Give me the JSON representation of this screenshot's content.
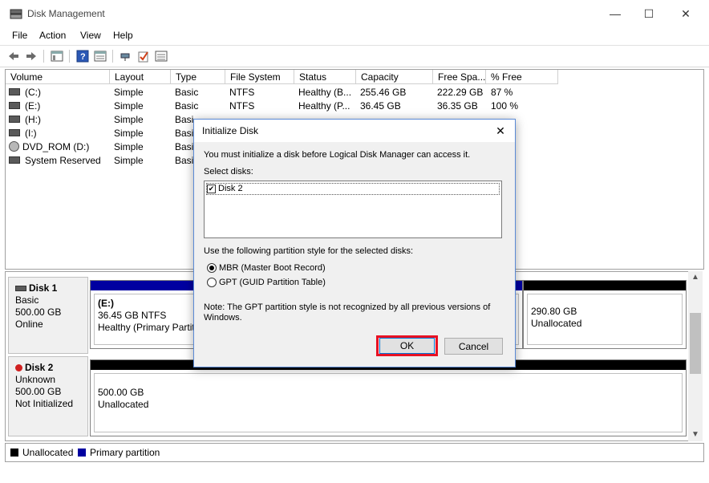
{
  "window": {
    "title": "Disk Management",
    "minimize": "—",
    "maximize": "☐",
    "close": "✕"
  },
  "menu": [
    "File",
    "Action",
    "View",
    "Help"
  ],
  "volumes": {
    "headers": [
      "Volume",
      "Layout",
      "Type",
      "File System",
      "Status",
      "Capacity",
      "Free Spa...",
      "% Free"
    ],
    "rows": [
      {
        "volume": "(C:)",
        "layout": "Simple",
        "type": "Basic",
        "fs": "NTFS",
        "status": "Healthy (B...",
        "capacity": "255.46 GB",
        "free": "222.29 GB",
        "pct": "87 %"
      },
      {
        "volume": "(E:)",
        "layout": "Simple",
        "type": "Basic",
        "fs": "NTFS",
        "status": "Healthy (P...",
        "capacity": "36.45 GB",
        "free": "36.35 GB",
        "pct": "100 %"
      },
      {
        "volume": "(H:)",
        "layout": "Simple",
        "type": "Basi",
        "fs": "",
        "status": "",
        "capacity": "",
        "free": "",
        "pct": ""
      },
      {
        "volume": "(I:)",
        "layout": "Simple",
        "type": "Basi",
        "fs": "",
        "status": "",
        "capacity": "",
        "free": "",
        "pct": ""
      },
      {
        "volume": "DVD_ROM (D:)",
        "layout": "Simple",
        "type": "Basi",
        "fs": "",
        "status": "",
        "capacity": "",
        "free": "",
        "pct": ""
      },
      {
        "volume": "System Reserved",
        "layout": "Simple",
        "type": "Basi",
        "fs": "",
        "status": "",
        "capacity": "",
        "free": "",
        "pct": ""
      }
    ]
  },
  "disks": {
    "disk1": {
      "name": "Disk 1",
      "type": "Basic",
      "size": "500.00 GB",
      "state": "Online",
      "part1": {
        "label": "(E:)",
        "line1": "36.45 GB NTFS",
        "line2": "Healthy (Primary Partiti"
      },
      "part2": {
        "line1": "290.80 GB",
        "line2": "Unallocated"
      }
    },
    "disk2": {
      "name": "Disk 2",
      "type": "Unknown",
      "size": "500.00 GB",
      "state": "Not Initialized",
      "part1": {
        "line1": "500.00 GB",
        "line2": "Unallocated"
      }
    }
  },
  "legend": {
    "unallocated": "Unallocated",
    "primary": "Primary partition"
  },
  "colors": {
    "primary": "#0000a0",
    "unallocated": "#000000",
    "highlight": "#e81123"
  },
  "dialog": {
    "title": "Initialize Disk",
    "intro": "You must initialize a disk before Logical Disk Manager can access it.",
    "select_label": "Select disks:",
    "disk_item": "Disk 2",
    "style_label": "Use the following partition style for the selected disks:",
    "mbr": "MBR (Master Boot Record)",
    "gpt": "GPT (GUID Partition Table)",
    "note_line1": "Note: The GPT partition style is not recognized by all previous versions of",
    "note_line2": "Windows.",
    "ok": "OK",
    "cancel": "Cancel"
  }
}
